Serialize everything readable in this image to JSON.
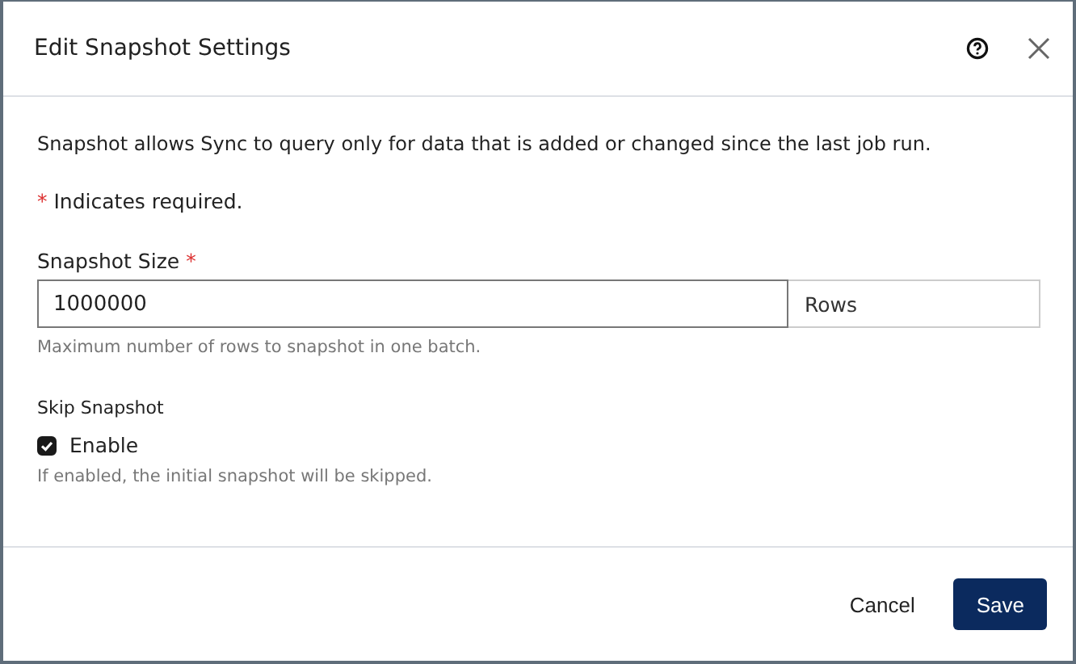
{
  "dialog": {
    "title": "Edit Snapshot Settings",
    "description": "Snapshot allows Sync to query only for data that is added or changed since the last job run.",
    "required_note": {
      "mark": "*",
      "text": "Indicates required."
    },
    "snapshot_size": {
      "label": "Snapshot Size",
      "required_mark": "*",
      "value": "1000000",
      "unit": "Rows",
      "help": "Maximum number of rows to snapshot in one batch."
    },
    "skip_snapshot": {
      "label": "Skip Snapshot",
      "checkbox_label": "Enable",
      "checked": true,
      "help": "If enabled, the initial snapshot will be skipped."
    },
    "buttons": [
      {
        "label": "Cancel",
        "kind": "secondary"
      },
      {
        "label": "Save",
        "kind": "primary"
      }
    ]
  }
}
